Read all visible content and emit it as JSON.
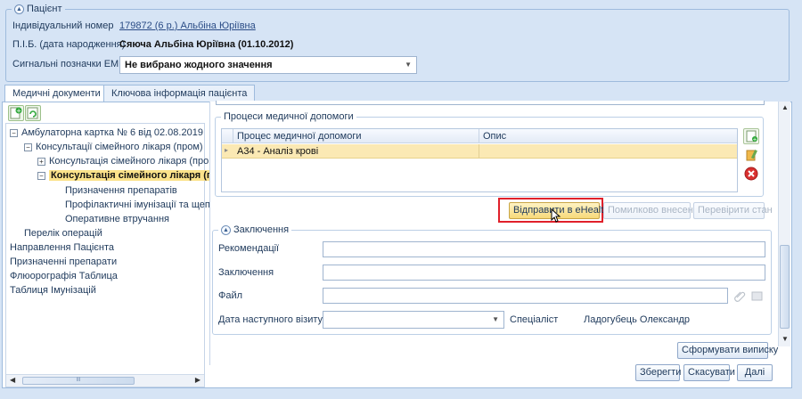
{
  "patient": {
    "legend": "Пацієнт",
    "id_label": "Індивідуальний номер",
    "id_value": "179872 (6 р.) Альбіна Юріївна",
    "name_label": "П.І.Б. (дата народження)",
    "name_value": "Сяюча Альбіна Юріївна (01.10.2012)",
    "signal_label": "Сигнальні позначки ЕМК",
    "signal_value": "Не вибрано жодного значення"
  },
  "tabs": [
    {
      "label": "Медичні документи"
    },
    {
      "label": "Ключова інформація пацієнта"
    }
  ],
  "tree": [
    {
      "label": "Амбулаторна картка № 6 від 02.08.2019",
      "toggle": "⊟"
    },
    {
      "label": "Консультації сімейного лікаря (пром)",
      "toggle": "⊟"
    },
    {
      "label": "Консультація сімейного лікаря (пром",
      "toggle": "⊞"
    },
    {
      "label": "Консультація сімейного лікаря (пр",
      "toggle": "⊟"
    },
    {
      "label": "Призначення препаратів"
    },
    {
      "label": "Профілактичні імунізації та щепле"
    },
    {
      "label": "Оперативне втручання"
    },
    {
      "label": "Перелік операцій"
    },
    {
      "label": "Направлення Пацієнта"
    },
    {
      "label": "Призначенні препарати"
    },
    {
      "label": "Флюорографія Таблица"
    },
    {
      "label": "Таблиця Імунізацій"
    }
  ],
  "processes": {
    "legend": "Процеси медичної допомоги",
    "col1": "Процес медичної допомоги",
    "col2": "Опис",
    "row_process": "А34 - Аналіз крові",
    "row_desc": ""
  },
  "actions": {
    "send": "Відправити в eHealth",
    "mistaken": "Помилково внесена",
    "check": "Перевірити стан"
  },
  "conclusion": {
    "legend": "Заключення",
    "recommend_label": "Рекомендації",
    "conclusion_label": "Заключення",
    "file_label": "Файл",
    "next_visit_label": "Дата наступного візиту",
    "specialist_label": "Спеціаліст",
    "specialist_value": "Ладогубець Олександр"
  },
  "footer": {
    "extract": "Сформувати виписку",
    "save": "Зберегти",
    "cancel": "Скасувати",
    "next": "Далі"
  },
  "hscroll": {
    "thumb": "III"
  }
}
